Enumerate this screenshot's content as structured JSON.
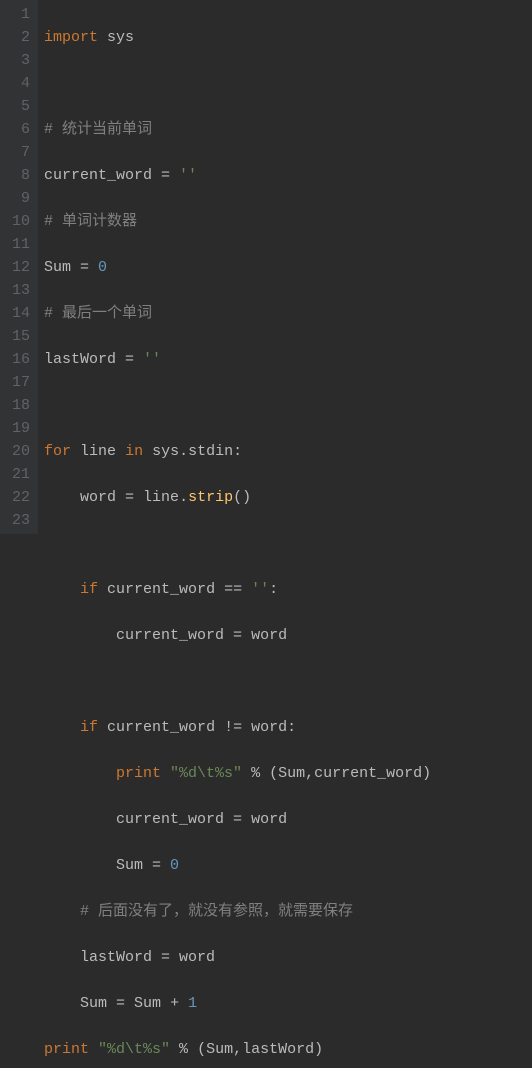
{
  "gutter": [
    "1",
    "2",
    "3",
    "4",
    "5",
    "6",
    "7",
    "8",
    "9",
    "10",
    "11",
    "12",
    "13",
    "14",
    "15",
    "16",
    "17",
    "18",
    "19",
    "20",
    "21",
    "22",
    "23"
  ],
  "t": {
    "import": "import",
    "sys": "sys",
    "c1": "# 统计当前单词",
    "cw": "current_word",
    "eq": " = ",
    "empty": "''",
    "c2": "# 单词计数器",
    "sum": "Sum",
    "zero": "0",
    "c3": "# 最后一个单词",
    "lw": "lastWord",
    "for": "for",
    "line": "line",
    "in": "in",
    "stdin": ".stdin:",
    "word": "word",
    "linev": "line",
    "dot": ".",
    "strip": "strip",
    "parens": "()",
    "if": "if",
    "eqeq": " == ",
    "colon": ":",
    "neq": " != ",
    "wordv": "word",
    "print": "print",
    "fmt": "\"%d\\t%s\"",
    "pct": " % ",
    "args1": "(Sum,current_word)",
    "args2": "(Sum,lastWord)",
    "c4": "# 后面没有了，就没有参照，就需要保存",
    "plus": " + ",
    "one": "1"
  }
}
